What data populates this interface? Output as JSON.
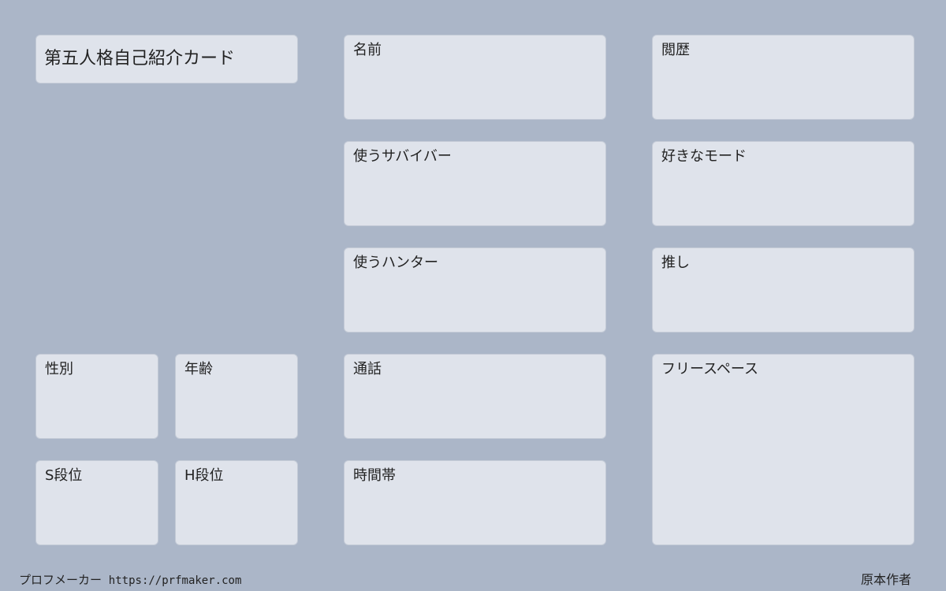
{
  "title": "第五人格自己紹介カード",
  "fields": {
    "name": "名前",
    "history": "閲歴",
    "survivor": "使うサバイバー",
    "mode": "好きなモード",
    "hunter": "使うハンター",
    "oshi": "推し",
    "gender": "性別",
    "age": "年齢",
    "call": "通話",
    "free_space": "フリースペース",
    "s_rank": "S段位",
    "h_rank": "H段位",
    "time": "時間帯"
  },
  "footer": {
    "maker": "プロフメーカー",
    "url": "https://prfmaker.com",
    "author": "原本作者"
  }
}
